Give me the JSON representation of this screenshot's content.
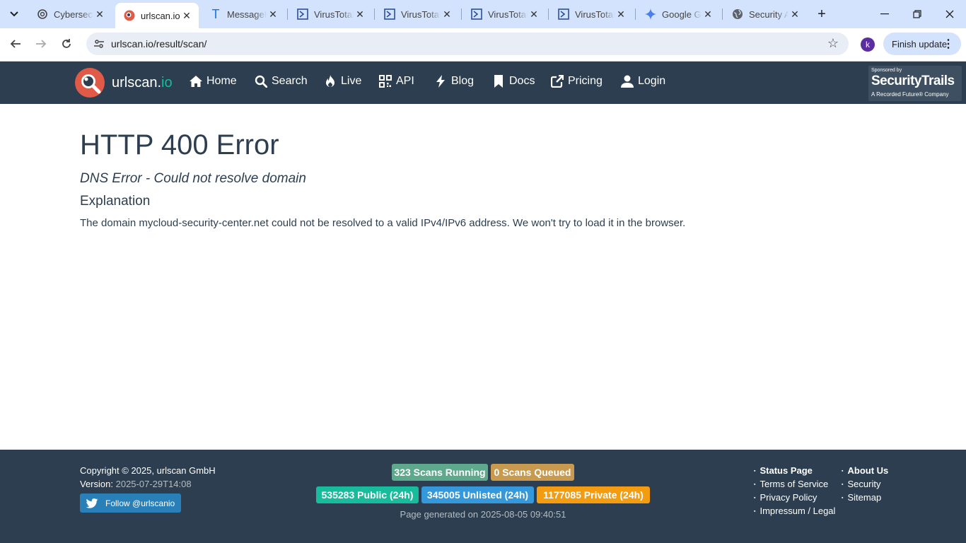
{
  "browser": {
    "tabs": [
      {
        "title": "Cybersecurity",
        "icon": "openai-icon"
      },
      {
        "title": "urlscan.io",
        "icon": "urlscan-icon"
      },
      {
        "title": "MessageHeader",
        "icon": "t-letter-icon"
      },
      {
        "title": "VirusTotal",
        "icon": "virustotal-icon"
      },
      {
        "title": "VirusTotal",
        "icon": "virustotal-icon"
      },
      {
        "title": "VirusTotal",
        "icon": "virustotal-icon"
      },
      {
        "title": "VirusTotal",
        "icon": "virustotal-icon"
      },
      {
        "title": "Google Gemini",
        "icon": "gemini-icon"
      },
      {
        "title": "Security Alert",
        "icon": "globe-icon"
      }
    ],
    "url": "urlscan.io/result/scan/",
    "profile_initial": "k",
    "finish_update_label": "Finish update"
  },
  "site": {
    "brand_main": "urlscan.",
    "brand_io": "io",
    "nav": [
      {
        "label": "Home",
        "icon": "home-icon"
      },
      {
        "label": "Search",
        "icon": "search-icon"
      },
      {
        "label": "Live",
        "icon": "fire-icon"
      },
      {
        "label": "API",
        "icon": "qrcode-icon"
      },
      {
        "label": "Blog",
        "icon": "bolt-icon"
      },
      {
        "label": "Docs",
        "icon": "bookmark-icon"
      },
      {
        "label": "Pricing",
        "icon": "external-link-icon"
      },
      {
        "label": "Login",
        "icon": "user-icon"
      }
    ],
    "sponsor": {
      "line1": "Sponsored by",
      "line2": "SecurityTrails",
      "line3": "A Recorded Future® Company"
    }
  },
  "error": {
    "title": "HTTP 400 Error",
    "subtitle": "DNS Error - Could not resolve domain",
    "explanation_heading": "Explanation",
    "explanation_text": "The domain mycloud-security-center.net could not be resolved to a valid IPv4/IPv6 address. We won't try to load it in the browser."
  },
  "footer": {
    "copyright": "Copyright © 2025, urlscan GmbH",
    "version_label": "Version:",
    "version_value": "2025-07-29T14:08",
    "twitter_label": "Follow @urlscanio",
    "badges": {
      "running": "323 Scans Running",
      "queued": "0 Scans Queued",
      "public": "535283 Public (24h)",
      "unlisted": "345005 Unlisted (24h)",
      "private": "1177085 Private (24h)"
    },
    "badge_colors": {
      "running": "#5ea98e",
      "queued": "#c79a4f",
      "public": "#18bc9c",
      "unlisted": "#3498db",
      "private": "#f39c12"
    },
    "generated": "Page generated on 2025-08-05 09:40:51",
    "links_col1": [
      "Status Page",
      "Terms of Service",
      "Privacy Policy",
      "Impressum / Legal"
    ],
    "links_col2": [
      "About Us",
      "Security",
      "Sitemap"
    ]
  }
}
